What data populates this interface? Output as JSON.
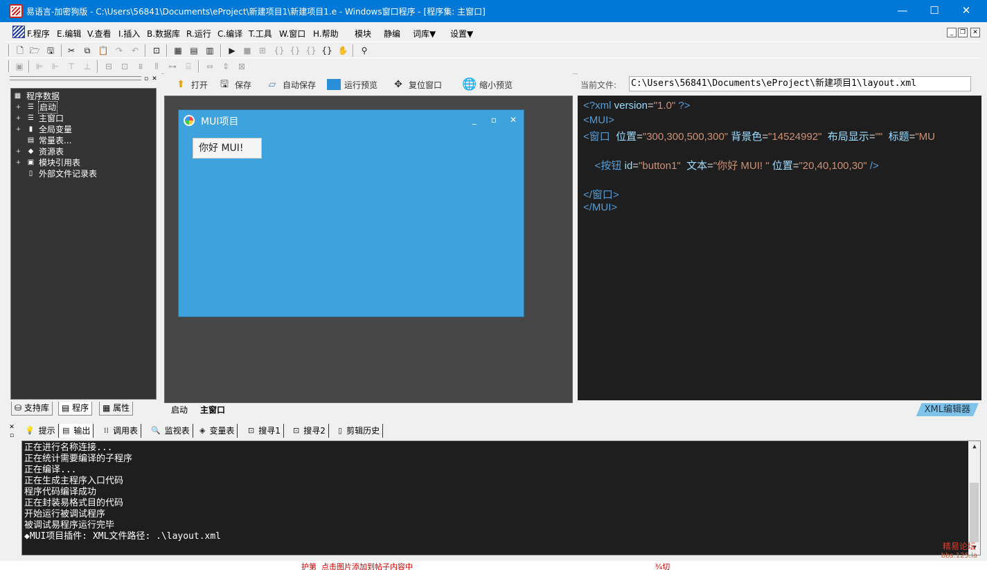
{
  "window": {
    "title": "易语言-加密狗版 - C:\\Users\\56841\\Documents\\eProject\\新建项目1\\新建项目1.e - Windows窗口程序 - [程序集: 主窗口]",
    "minimize": "—",
    "maximize": "☐",
    "close": "✕"
  },
  "menu": {
    "items": [
      "F.程序",
      "E.编辑",
      "V.查看",
      "I.插入",
      "B.数据库",
      "R.运行",
      "C.编译",
      "T.工具",
      "W.窗口",
      "H.帮助",
      "模块",
      "静编",
      "词库▼",
      "设置▼"
    ]
  },
  "left_panel": {
    "tree_root": "程序数据",
    "tree_items": [
      "启动",
      "主窗口",
      "全局变量",
      "常量表...",
      "资源表",
      "模块引用表",
      "外部文件记录表"
    ],
    "tabs": [
      "支持库",
      "程序",
      "属性"
    ]
  },
  "design": {
    "toolbar": [
      "打开",
      "保存",
      "自动保存",
      "运行预览",
      "复位窗口",
      "缩小预览"
    ],
    "mui_window_title": "MUI项目",
    "mui_button_label": "你好 MUI!",
    "tabs": [
      "启动",
      "主窗口"
    ]
  },
  "editor": {
    "file_label": "当前文件:",
    "file_path": "C:\\Users\\56841\\Documents\\eProject\\新建项目1\\layout.xml",
    "tab_label": "XML编辑器",
    "lines": [
      {
        "segments": [
          [
            "c-tag",
            "<?xml "
          ],
          [
            "c-attr",
            "version"
          ],
          [
            "c-eq",
            "="
          ],
          [
            "c-val",
            "\"1.0\""
          ],
          [
            "c-tag",
            " ?>"
          ]
        ]
      },
      {
        "segments": [
          [
            "c-tag",
            "<MUI>"
          ]
        ]
      },
      {
        "segments": [
          [
            "c-tag",
            "<窗口 "
          ],
          [
            "c-attr",
            " 位置"
          ],
          [
            "c-eq",
            "="
          ],
          [
            "c-val",
            "\"300,300,500,300\""
          ],
          [
            "c-attr",
            " 背景色"
          ],
          [
            "c-eq",
            "="
          ],
          [
            "c-val",
            "\"14524992\""
          ],
          [
            "c-attr",
            "  布局显示"
          ],
          [
            "c-eq",
            "="
          ],
          [
            "c-val",
            "\"\""
          ],
          [
            "c-attr",
            "  标题"
          ],
          [
            "c-eq",
            "="
          ],
          [
            "c-val",
            "\"MU"
          ]
        ]
      },
      {
        "segments": []
      },
      {
        "segments": [
          [
            "c-tag",
            "    <按钮 "
          ],
          [
            "c-attr",
            "id"
          ],
          [
            "c-eq",
            "="
          ],
          [
            "c-val",
            "\"button1\""
          ],
          [
            "c-attr",
            "  文本"
          ],
          [
            "c-eq",
            "="
          ],
          [
            "c-val",
            "\"你好 MUI! \""
          ],
          [
            "c-attr",
            " 位置"
          ],
          [
            "c-eq",
            "="
          ],
          [
            "c-val",
            "\"20,40,100,30\""
          ],
          [
            "c-tag",
            " />"
          ]
        ]
      },
      {
        "segments": []
      },
      {
        "segments": [
          [
            "c-tag",
            "</窗口>"
          ]
        ]
      },
      {
        "segments": [
          [
            "c-tag",
            "</MUI>"
          ]
        ]
      }
    ]
  },
  "bottom": {
    "tabs": [
      "提示",
      "输出",
      "调用表",
      "监视表",
      "变量表",
      "搜寻1",
      "搜寻2",
      "剪辑历史"
    ],
    "output_lines": [
      "正在进行名称连接...",
      "正在统计需要编译的子程序",
      "正在编译...",
      "正在生成主程序入口代码",
      "程序代码编译成功",
      "正在封装易格式目的代码",
      "开始运行被调试程序",
      "被调试易程序运行完毕",
      "◆MUI项目插件: XML文件路径: .\\layout.xml"
    ]
  },
  "watermark": {
    "line1": "精易论坛",
    "line2": "bbs.125.la"
  },
  "behind_text": "护第  点击图片添加到帖子内容中                                                                                                    ¾切"
}
